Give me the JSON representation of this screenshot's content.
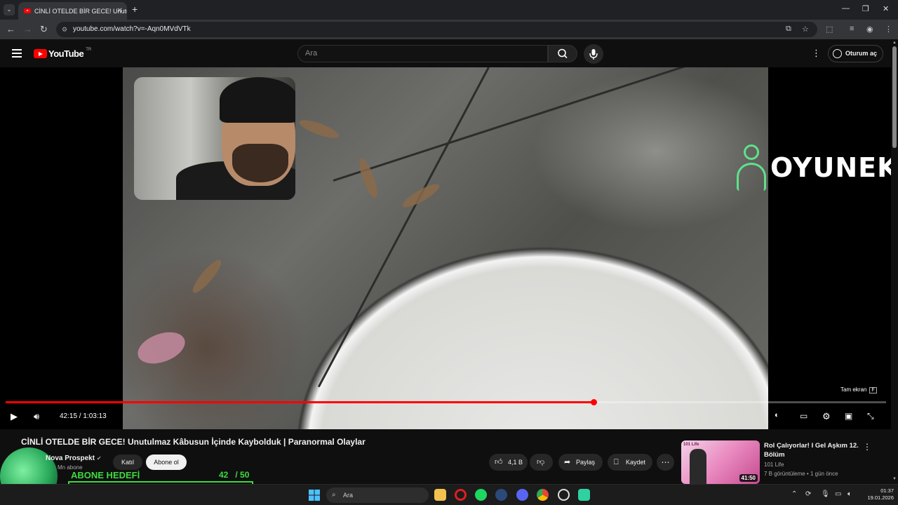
{
  "browser": {
    "tab_title": "CİNLİ OTELDE BİR GECE! Unutul",
    "url": "youtube.com/watch?v=-Aqn0MVdVTk"
  },
  "header": {
    "logo_text": "YouTube",
    "region": "TR",
    "search_placeholder": "Ara",
    "signin_label": "Oturum aç"
  },
  "player": {
    "overlay_brand": "OYUNEKS",
    "fullscreen_tip": "Tam ekran",
    "fullscreen_key": "F",
    "current_time": "42:15",
    "duration": "1:03:13",
    "progress_fraction": 0.668
  },
  "video": {
    "title": "CİNLİ OTELDE BİR GECE! Unutulmaz Kâbusun İçinde Kaybolduk | Paranormal Olaylar",
    "channel_name": "Nova Prospekt",
    "subscribers": "Mn abone",
    "join_label": "Katıl",
    "subscribe_label": "Abone ol",
    "likes": "4,1 B",
    "share_label": "Paylaş",
    "save_label": "Kaydet"
  },
  "overlay_goal": {
    "label": "ABONE HEDEFİ",
    "current": "42",
    "target": "/ 50",
    "progress_fraction": 0.84
  },
  "recommendation": {
    "title": "Rol Çalıyorlar! I Gel Aşkım 12. Bölüm",
    "channel": "101 Life",
    "meta": "7 B görüntüleme • 1 gün önce",
    "duration": "41:50",
    "thumb_tag": "101 Life"
  },
  "taskbar": {
    "search_placeholder": "Ara",
    "time": "01:37",
    "date": "19.01.2026"
  },
  "colors": {
    "accent_red": "#ff0000",
    "goal_green": "#3ddc3d",
    "overlay_logo_green": "#5ee28a"
  }
}
